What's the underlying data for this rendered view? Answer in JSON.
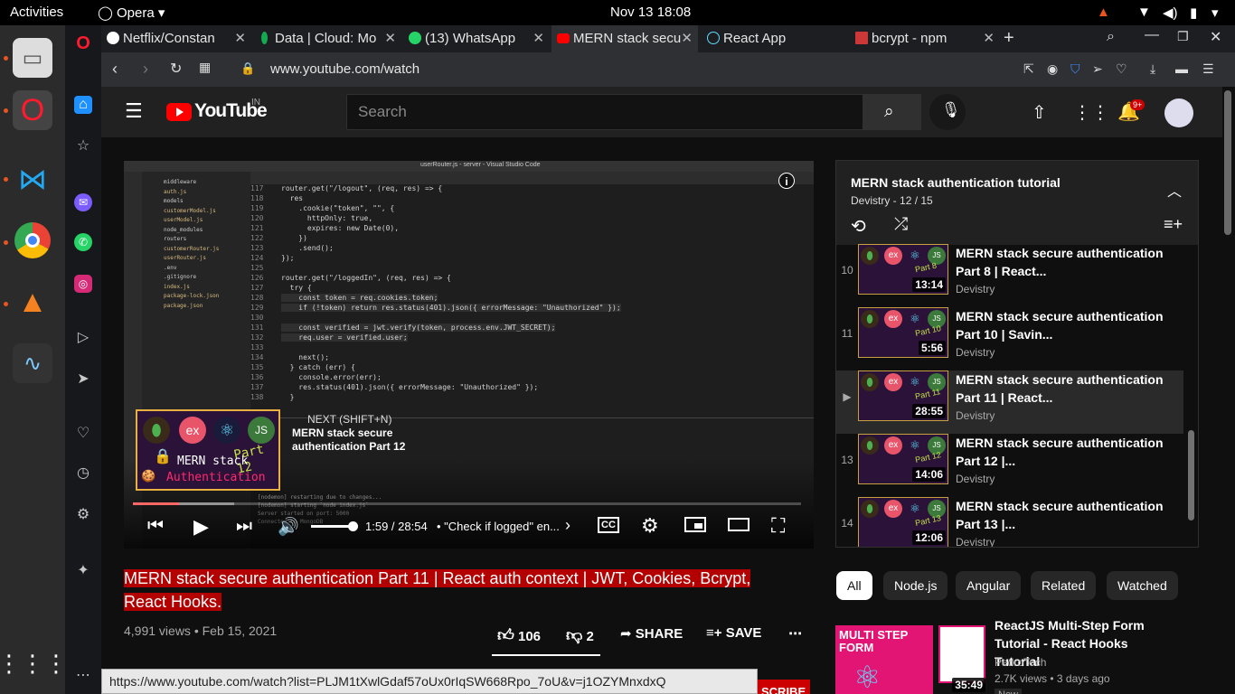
{
  "system": {
    "activities": "Activities",
    "app": "Opera",
    "datetime": "Nov 13  18:08"
  },
  "tabs": [
    {
      "label": "Netflix/Constan",
      "color": "#ffffff"
    },
    {
      "label": "Data | Cloud: Mo",
      "color": "#13aa52"
    },
    {
      "label": "(13) WhatsApp",
      "color": "#25d366"
    },
    {
      "label": "MERN stack secu",
      "color": "#ff0000"
    },
    {
      "label": "React App",
      "color": "#61dafb"
    },
    {
      "label": "bcrypt - npm",
      "color": "#cb3837"
    }
  ],
  "address": {
    "url": "www.youtube.com/watch"
  },
  "youtube": {
    "logo": "YouTube",
    "region": "IN",
    "search_placeholder": "Search",
    "notif_count": "9+",
    "video": {
      "title": "MERN stack secure authentication Part 11 | React auth context | JWT, Cookies, Bcrypt, React Hooks.",
      "views": "4,991 views",
      "date": "Feb 15, 2021",
      "likes": "106",
      "dislikes": "2",
      "share": "SHARE",
      "save": "SAVE",
      "time": "1:59 / 28:54",
      "chapter": "• \"Check if logged\" en...",
      "progress": 0.069,
      "next_label": "NEXT (SHIFT+N)",
      "next_title": "MERN stack secure authentication Part 12",
      "thumb_line1": "MERN stack",
      "thumb_line2": "Authentication",
      "thumb_part": "Part 12",
      "editor_title": "userRouter.js - server - Visual Studio Code",
      "code": [
        {
          "n": "117",
          "t": "router.get(\"/logout\", (req, res) => {"
        },
        {
          "n": "118",
          "t": "  res"
        },
        {
          "n": "119",
          "t": "    .cookie(\"token\", \"\", {"
        },
        {
          "n": "120",
          "t": "      httpOnly: true,"
        },
        {
          "n": "121",
          "t": "      expires: new Date(0),"
        },
        {
          "n": "122",
          "t": "    })"
        },
        {
          "n": "123",
          "t": "    .send();"
        },
        {
          "n": "124",
          "t": "});"
        },
        {
          "n": "125",
          "t": ""
        },
        {
          "n": "126",
          "t": "router.get(\"/loggedIn\", (req, res) => {"
        },
        {
          "n": "127",
          "t": "  try {"
        },
        {
          "n": "128",
          "t": "    const token = req.cookies.token;"
        },
        {
          "n": "129",
          "t": "    if (!token) return res.status(401).json({ errorMessage: \"Unauthorized\" });"
        },
        {
          "n": "130",
          "t": ""
        },
        {
          "n": "131",
          "t": "    const verified = jwt.verify(token, process.env.JWT_SECRET);"
        },
        {
          "n": "132",
          "t": "    req.user = verified.user;"
        },
        {
          "n": "133",
          "t": ""
        },
        {
          "n": "134",
          "t": "    next();"
        },
        {
          "n": "135",
          "t": "  } catch (err) {"
        },
        {
          "n": "136",
          "t": "    console.error(err);"
        },
        {
          "n": "137",
          "t": "    res.status(401).json({ errorMessage: \"Unauthorized\" });"
        },
        {
          "n": "138",
          "t": "  }"
        }
      ],
      "files": [
        "middleware",
        "auth.js",
        "models",
        "customerModel.js",
        "userModel.js",
        "node_modules",
        "routers",
        "customerRouter.js",
        "userRouter.js",
        ".env",
        ".gitignore",
        "index.js",
        "package-lock.json",
        "package.json"
      ],
      "terminal": [
        "[nodemon] restarting due to changes...",
        "[nodemon] starting `node index.js`",
        "Server started on port: 5000",
        "Connected to MongoDB"
      ]
    },
    "playlist": {
      "title": "MERN stack authentication tutorial",
      "channel": "Devistry",
      "position": "12 / 15",
      "items": [
        {
          "num": "10",
          "title": "MERN stack secure authentication Part 8 | React...",
          "channel": "Devistry",
          "duration": "13:14",
          "part": "Part 8"
        },
        {
          "num": "11",
          "title": "MERN stack secure authentication Part 10 | Savin...",
          "channel": "Devistry",
          "duration": "5:56",
          "part": "Part 10"
        },
        {
          "num": "▶",
          "title": "MERN stack secure authentication Part 11 | React...",
          "channel": "Devistry",
          "duration": "28:55",
          "part": "Part 11"
        },
        {
          "num": "13",
          "title": "MERN stack secure authentication Part 12 |...",
          "channel": "Devistry",
          "duration": "14:06",
          "part": "Part 12"
        },
        {
          "num": "14",
          "title": "MERN stack secure authentication Part 13 |...",
          "channel": "Devistry",
          "duration": "12:06",
          "part": "Part 13"
        }
      ]
    },
    "chips": [
      "All",
      "Node.js",
      "Angular",
      "Related",
      "Watched"
    ],
    "recommended": {
      "title": "ReactJS Multi-Step Form Tutorial - React Hooks Tutorial",
      "channel": "PedroTech",
      "meta": "2.7K views • 3 days ago",
      "duration": "35:49",
      "thumb_text": "MULTI STEP FORM",
      "badge": "New"
    },
    "subscribe": "SCRIBE"
  },
  "statusbar": {
    "link": "https://www.youtube.com/watch?list=PLJM1tXwlGdaf57oUx0rIqSW668Rpo_7oU&v=j1OZYMnxdxQ"
  },
  "colors": {
    "yt_red": "#ff0000",
    "accent": "#e95420"
  }
}
